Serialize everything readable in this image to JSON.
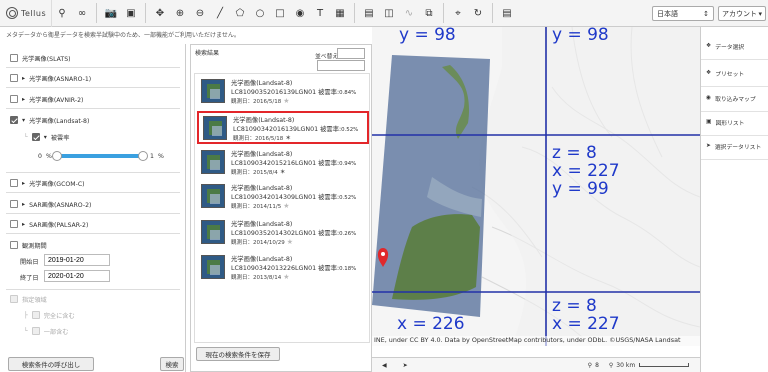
{
  "app": {
    "logo_text": "Tellus"
  },
  "toolbar": {
    "icons": [
      "search-icon",
      "infinity-icon",
      "camera-icon",
      "image-icon",
      "move-icon",
      "zoom-in-icon",
      "zoom-out-icon",
      "line-icon",
      "polygon-icon",
      "circle-icon",
      "rectangle-icon",
      "marker-icon",
      "text-icon",
      "delete-icon",
      "panel-icon",
      "split-icon",
      "link-icon",
      "layers-icon",
      "crop-icon",
      "reload-icon",
      "document-icon"
    ],
    "language": "日本語",
    "account": "アカウント"
  },
  "notice": "メタデータから衛星データを検索半試験中のため、一部機能がご利用いただけません。",
  "search_panel": {
    "datasets": [
      {
        "label": "光学画像(SLATS)",
        "checked": false,
        "expandable": false
      },
      {
        "label": "光学画像(ASNARO-1)",
        "checked": false,
        "expandable": true
      },
      {
        "label": "光学画像(AVNIR-2)",
        "checked": false,
        "expandable": true
      },
      {
        "label": "光学画像(Landsat-8)",
        "checked": true,
        "expandable": true
      },
      {
        "label": "光学画像(GCOM-C)",
        "checked": false,
        "expandable": true
      },
      {
        "label": "SAR画像(ASNARO-2)",
        "checked": false,
        "expandable": true
      },
      {
        "label": "SAR画像(PALSAR-2)",
        "checked": false,
        "expandable": true
      }
    ],
    "cloud": {
      "label": "被雲率",
      "min": "0",
      "max": "1",
      "unit": "%",
      "min_unit": "%"
    },
    "period": {
      "label": "観測期間",
      "start_label": "開始日",
      "start": "2019-01-20",
      "end_label": "終了日",
      "end": "2020-01-20"
    },
    "area": {
      "label": "指定領域",
      "opt1": "完全に含む",
      "opt2": "一部含む"
    },
    "recall_button": "検索条件の呼び出し",
    "search_button": "検索"
  },
  "results": {
    "title": "検索結果",
    "sort_label": "並べ替え",
    "save_button": "現在の検索条件を保存",
    "items": [
      {
        "title": "光学画像(Landsat-8)",
        "id": "LC81090352016139LGN01",
        "cloud_label": "被雲率:",
        "cloud": "0.84%",
        "date": "観測日：2016/5/18",
        "selected": false
      },
      {
        "title": "光学画像(Landsat-8)",
        "id": "LC81090342016139LGN01",
        "cloud_label": "被雲率:",
        "cloud": "0.52%",
        "date": "観測日：2016/5/18",
        "selected": true
      },
      {
        "title": "光学画像(Landsat-8)",
        "id": "LC81090342015216LGN01",
        "cloud_label": "被雲率:",
        "cloud": "0.94%",
        "date": "観測日：2015/8/4",
        "selected": false
      },
      {
        "title": "光学画像(Landsat-8)",
        "id": "LC81090342014309LGN01",
        "cloud_label": "被雲率:",
        "cloud": "0.52%",
        "date": "観測日：2014/11/5",
        "selected": false
      },
      {
        "title": "光学画像(Landsat-8)",
        "id": "LC81090352014302LGN01",
        "cloud_label": "被雲率:",
        "cloud": "0.26%",
        "date": "観測日：2014/10/29",
        "selected": false
      },
      {
        "title": "光学画像(Landsat-8)",
        "id": "LC81090342013226LGN01",
        "cloud_label": "被雲率:",
        "cloud": "0.18%",
        "date": "観測日：2013/8/14",
        "selected": false
      }
    ]
  },
  "map": {
    "tile_labels": [
      {
        "text": "y = 98"
      },
      {
        "text": "y = 98"
      },
      {
        "text": "z = 8"
      },
      {
        "text": "x = 227"
      },
      {
        "text": "y = 99"
      },
      {
        "text": "z = 8"
      },
      {
        "text": "x = 227"
      },
      {
        "text": "x = 226"
      }
    ],
    "attribution": "INE, under CC BY 4.0. Data by OpenStreetMap contributors, under ODbL. ©USGS/NASA Landsat",
    "status": {
      "zoom": "8",
      "scale": "30 km"
    }
  },
  "right_panel": {
    "items": [
      {
        "icon": "dataset-icon",
        "label": "データ選択"
      },
      {
        "icon": "preset-icon",
        "label": "プリセット"
      },
      {
        "icon": "map-import-icon",
        "label": "取り込みマップ"
      },
      {
        "icon": "shape-list-icon",
        "label": "図形リスト"
      },
      {
        "icon": "selected-data-icon",
        "label": "選択データリスト"
      }
    ]
  },
  "colors": {
    "accent": "#3aa0e0",
    "selection": "#e3262a",
    "tile_label": "#1f39c9"
  }
}
